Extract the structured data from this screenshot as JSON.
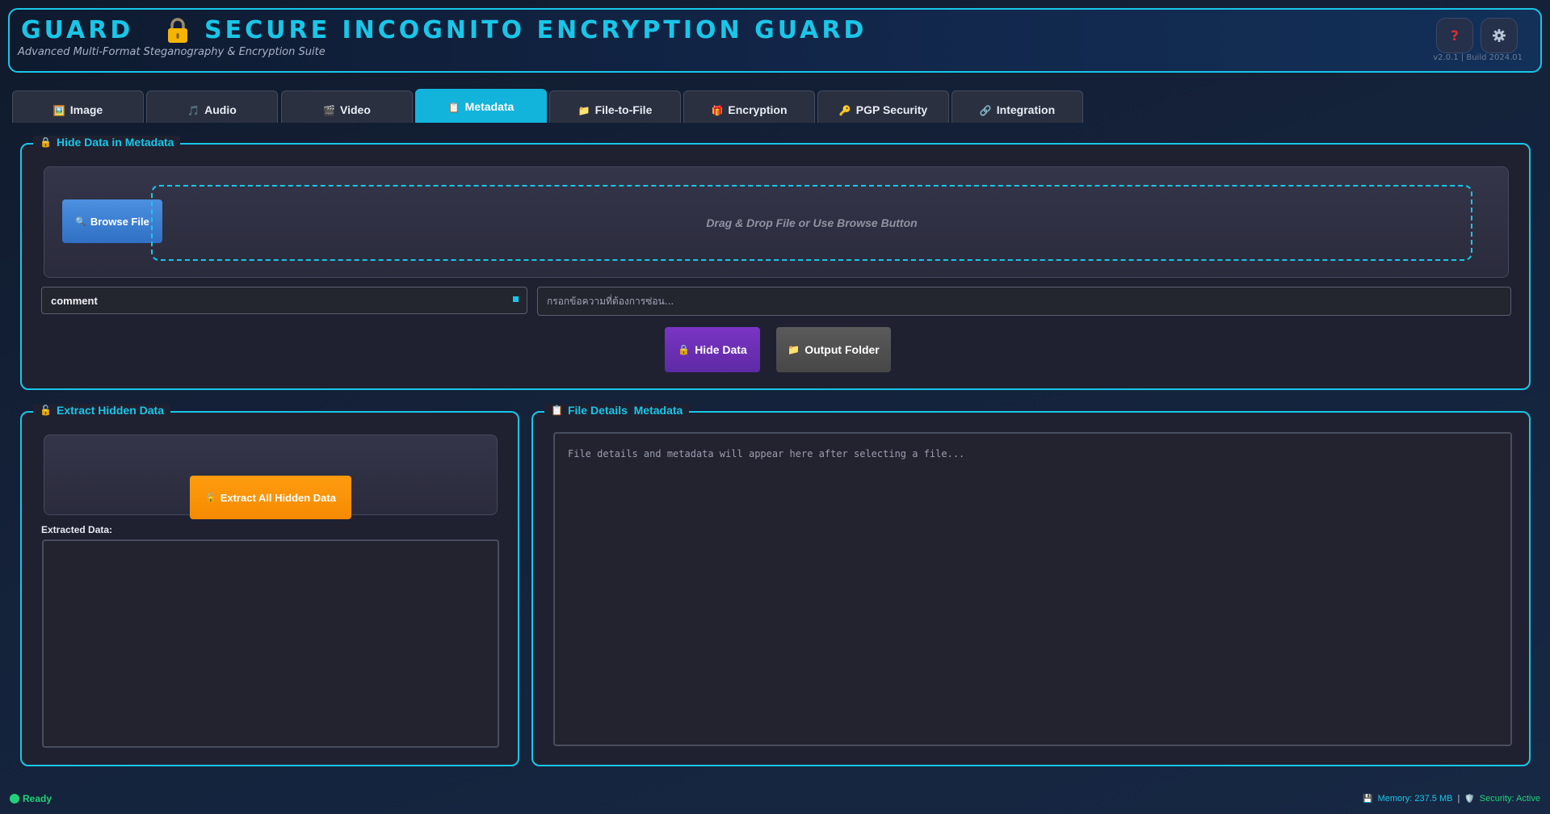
{
  "header": {
    "app_short": "GUARD",
    "title": "SECURE INCOGNITO ENCRYPTION GUARD",
    "subtitle": "Advanced Multi-Format Steganography & Encryption Suite",
    "version": "v2.0.1 | Build 2024.01",
    "help_icon": "question-icon",
    "settings_icon": "gear-icon"
  },
  "tabs": [
    {
      "label": "Image",
      "icon": "image-icon"
    },
    {
      "label": "Audio",
      "icon": "audio-icon"
    },
    {
      "label": "Video",
      "icon": "video-clapper-icon"
    },
    {
      "label": "Metadata",
      "icon": "clipboard-icon",
      "active": true
    },
    {
      "label": "File-to-File",
      "icon": "folder-icon"
    },
    {
      "label": "Encryption",
      "icon": "gift-lock-icon"
    },
    {
      "label": "PGP Security",
      "icon": "key-icon"
    },
    {
      "label": "Integration",
      "icon": "link-icon"
    }
  ],
  "hide_panel": {
    "title": "Hide Data in Metadata",
    "browse_label": "Browse File",
    "dropzone_text": "Drag & Drop File or Use Browse Button",
    "field_selected": "comment",
    "text_placeholder": "กรอกข้อความที่ต้องการซ่อน...",
    "hide_button": "Hide Data",
    "output_button": "Output Folder"
  },
  "extract_panel": {
    "title": "Extract Hidden Data",
    "extract_button": "Extract All Hidden Data",
    "extracted_label": "Extracted Data:",
    "extracted_value": ""
  },
  "details_panel": {
    "title": "File Details  Metadata",
    "placeholder": "File details and metadata will appear here after selecting a file..."
  },
  "status": {
    "state": "Ready",
    "memory": "Memory: 237.5 MB",
    "separator": "|",
    "security": "Security: Active"
  },
  "colors": {
    "accent": "#19c6e8",
    "active_tab": "#12b4dc",
    "hide_button": "#6a2fb4",
    "extract_button": "#ff9800",
    "browse_button": "#3d7fd4",
    "status_ok": "#21d17a"
  }
}
